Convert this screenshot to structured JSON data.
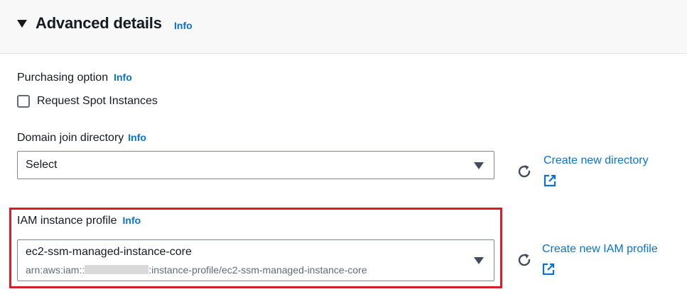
{
  "header": {
    "title": "Advanced details",
    "info": "Info"
  },
  "purchasing": {
    "label": "Purchasing option",
    "info": "Info",
    "checkbox_label": "Request Spot Instances",
    "checked": false
  },
  "domain_join": {
    "label": "Domain join directory",
    "info": "Info",
    "selected": "Select",
    "create_link": "Create new directory"
  },
  "iam_profile": {
    "label": "IAM instance profile",
    "info": "Info",
    "selected": "ec2-ssm-managed-instance-core",
    "arn_prefix": "arn:aws:iam::",
    "arn_suffix": ":instance-profile/ec2-ssm-managed-instance-core",
    "create_link": "Create new IAM profile"
  },
  "colors": {
    "link": "#0972d3",
    "highlight": "#d81e2a",
    "header_bg": "#f8f8f8"
  },
  "icons": [
    "caret-down-icon",
    "refresh-icon",
    "external-link-icon",
    "select-caret-icon"
  ]
}
